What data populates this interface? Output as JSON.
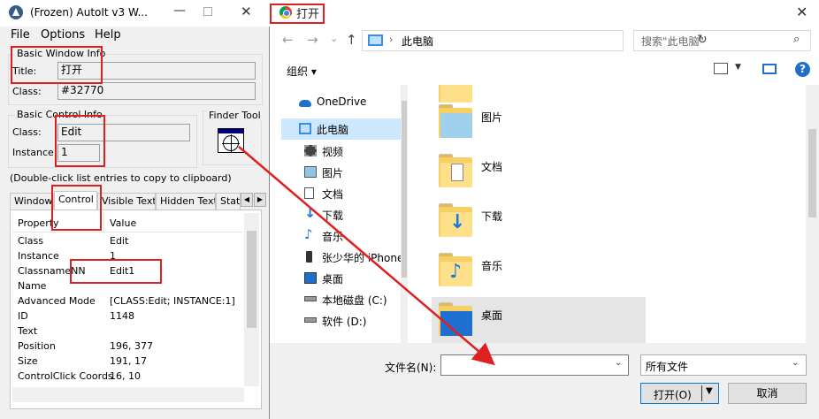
{
  "colors": {
    "annotation_red": "#e02020",
    "selection_blue": "#cce8ff",
    "folder_yellow": "#f6cf65",
    "accent_blue": "#0078d7"
  },
  "open_dialog": {
    "title": "打开",
    "icons": {
      "back": "back-arrow-icon",
      "forward": "forward-arrow-icon",
      "recent": "chevron-down-icon",
      "up": "up-arrow-icon",
      "refresh": "refresh-icon",
      "search": "search-icon",
      "view": "view-options-icon",
      "preview_pane": "preview-pane-icon",
      "help": "help-icon",
      "close": "close-icon"
    },
    "nav": {
      "back": "←",
      "forward": "→",
      "recent": "⌄",
      "up": "↑"
    },
    "address": {
      "path": "此电脑",
      "separator": "›"
    },
    "search_placeholder": "搜索\"此电脑\"",
    "toolbar": {
      "organize": "组织 ▾",
      "help": "?"
    },
    "nav_pane": [
      {
        "label": "OneDrive",
        "icon": "cloud-icon"
      },
      {
        "label": "此电脑",
        "icon": "computer-icon",
        "selected": true
      },
      {
        "label": "视频",
        "icon": "video-icon"
      },
      {
        "label": "图片",
        "icon": "pictures-icon"
      },
      {
        "label": "文档",
        "icon": "documents-icon"
      },
      {
        "label": "下载",
        "icon": "download-icon"
      },
      {
        "label": "音乐",
        "icon": "music-icon"
      },
      {
        "label": "张少华的 iPhone",
        "icon": "phone-icon"
      },
      {
        "label": "桌面",
        "icon": "desktop-icon"
      },
      {
        "label": "本地磁盘 (C:)",
        "icon": "drive-icon"
      },
      {
        "label": "软件 (D:)",
        "icon": "drive-icon"
      }
    ],
    "folders": [
      {
        "label": "",
        "icon": "folder-icon"
      },
      {
        "label": "图片",
        "icon": "pictures-folder-icon"
      },
      {
        "label": "文档",
        "icon": "documents-folder-icon"
      },
      {
        "label": "下载",
        "icon": "download-folder-icon"
      },
      {
        "label": "音乐",
        "icon": "music-folder-icon"
      },
      {
        "label": "桌面",
        "icon": "desktop-folder-icon",
        "selected": true
      }
    ],
    "filename_label": "文件名(N):",
    "filename_value": "",
    "filetype_value": "所有文件",
    "open_button": "打开(O)",
    "cancel_button": "取消"
  },
  "autoit": {
    "title": "(Frozen) AutoIt v3 W...",
    "menu": [
      "File",
      "Options",
      "Help"
    ],
    "basic_window_info": {
      "caption": "Basic Window Info",
      "title_label": "Title:",
      "title_value": "打开",
      "class_label": "Class:",
      "class_value": "#32770"
    },
    "basic_control_info": {
      "caption": "Basic Control Info",
      "class_label": "Class:",
      "class_value": "Edit",
      "instance_label": "Instance:",
      "instance_value": "1"
    },
    "finder_tool": "Finder Tool",
    "hint": "(Double-click list entries to copy to clipboard)",
    "tabs": [
      "Window",
      "Control",
      "Visible Text",
      "Hidden Text",
      "Stat"
    ],
    "active_tab": "Control",
    "list_headers": {
      "property": "Property",
      "value": "Value"
    },
    "rows": [
      {
        "k": "Class",
        "v": "Edit"
      },
      {
        "k": "Instance",
        "v": "1"
      },
      {
        "k": "ClassnameNN",
        "v": "Edit1"
      },
      {
        "k": "Name",
        "v": ""
      },
      {
        "k": "Advanced Mode",
        "v": "[CLASS:Edit; INSTANCE:1]"
      },
      {
        "k": "ID",
        "v": "1148"
      },
      {
        "k": "Text",
        "v": ""
      },
      {
        "k": "Position",
        "v": "196, 377"
      },
      {
        "k": "Size",
        "v": "191, 17"
      },
      {
        "k": "ControlClick Coords",
        "v": "16, 10"
      }
    ]
  }
}
